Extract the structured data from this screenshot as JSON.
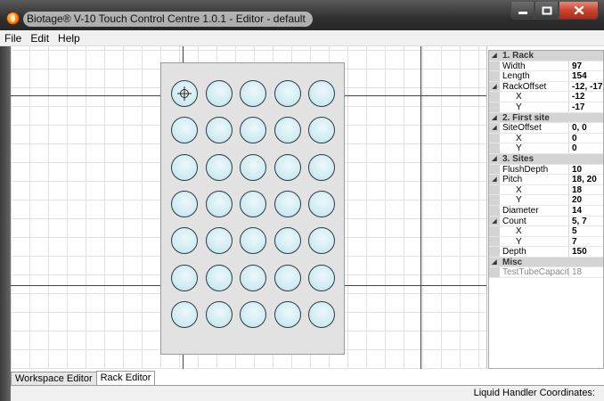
{
  "window": {
    "title": "Biotage® V-10 Touch Control Centre 1.0.1 - Editor  - default",
    "buttons": {
      "minimize_icon": "minimize-icon",
      "maximize_icon": "maximize-icon",
      "close_icon": "close-icon"
    }
  },
  "menu": [
    "File",
    "Edit",
    "Help"
  ],
  "canvas": {
    "rack": {
      "columns": 5,
      "rows": 7,
      "selected_well": "1,1"
    }
  },
  "properties": [
    {
      "kind": "category",
      "label": "1. Rack",
      "expanded": true
    },
    {
      "kind": "prop",
      "name": "Width",
      "value": "97"
    },
    {
      "kind": "prop",
      "name": "Length",
      "value": "154"
    },
    {
      "kind": "prop",
      "name": "RackOffset",
      "value": "-12, -17",
      "expandable": true
    },
    {
      "kind": "prop",
      "name": "X",
      "value": "-12",
      "sub": true
    },
    {
      "kind": "prop",
      "name": "Y",
      "value": "-17",
      "sub": true
    },
    {
      "kind": "category",
      "label": "2. First site",
      "expanded": true
    },
    {
      "kind": "prop",
      "name": "SiteOffset",
      "value": "0, 0",
      "expandable": true
    },
    {
      "kind": "prop",
      "name": "X",
      "value": "0",
      "sub": true
    },
    {
      "kind": "prop",
      "name": "Y",
      "value": "0",
      "sub": true
    },
    {
      "kind": "category",
      "label": "3. Sites",
      "expanded": true
    },
    {
      "kind": "prop",
      "name": "FlushDepth",
      "value": "10"
    },
    {
      "kind": "prop",
      "name": "Pitch",
      "value": "18, 20",
      "expandable": true
    },
    {
      "kind": "prop",
      "name": "X",
      "value": "18",
      "sub": true
    },
    {
      "kind": "prop",
      "name": "Y",
      "value": "20",
      "sub": true
    },
    {
      "kind": "prop",
      "name": "Diameter",
      "value": "14"
    },
    {
      "kind": "prop",
      "name": "Count",
      "value": "5, 7",
      "expandable": true
    },
    {
      "kind": "prop",
      "name": "X",
      "value": "5",
      "sub": true
    },
    {
      "kind": "prop",
      "name": "Y",
      "value": "7",
      "sub": true
    },
    {
      "kind": "prop",
      "name": "Depth",
      "value": "150"
    },
    {
      "kind": "category",
      "label": "Misc",
      "expanded": true
    },
    {
      "kind": "prop",
      "name": "TestTubeCapacity",
      "value": "18",
      "readonly": true
    }
  ],
  "tabs": [
    {
      "label": "Workspace Editor",
      "active": false
    },
    {
      "label": "Rack Editor",
      "active": true
    }
  ],
  "status": {
    "text": "Liquid Handler Coordinates:"
  },
  "colors": {
    "well_fill": "#d2edf3",
    "rack_fill": "#e2e2e2",
    "category_bg": "#d4d4d4"
  }
}
